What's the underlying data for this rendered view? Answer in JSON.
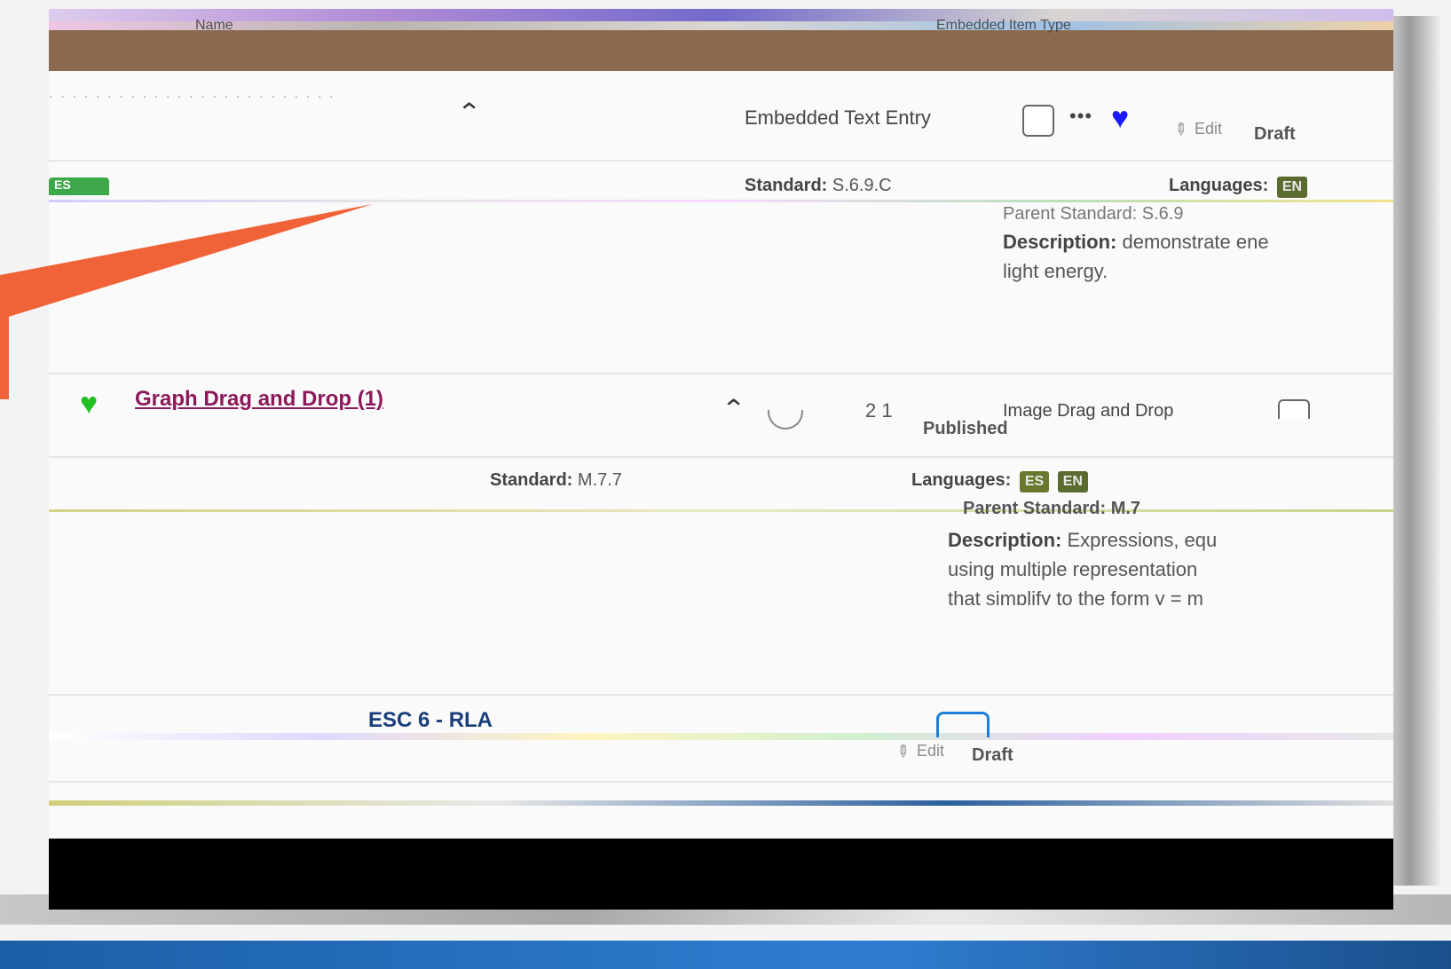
{
  "header": {
    "name_col": "Name",
    "type_col": "Embedded Item Type"
  },
  "rows": [
    {
      "type": "Embedded Text Entry",
      "status": "Draft",
      "edit_label": "Edit",
      "standard_label": "Standard:",
      "standard_value": "S.6.9.C",
      "languages_label": "Languages:",
      "languages": [
        "EN"
      ],
      "parent_standard_label": "Parent Standard:",
      "parent_standard_value": "S.6.9",
      "description_label": "Description:",
      "description_value": "demonstrate ene light energy.",
      "tag": "ES"
    },
    {
      "title": "Graph Drag and Drop (1)",
      "type": "Image Drag and Drop",
      "status": "Published",
      "counts": "2 1",
      "standard_label": "Standard:",
      "standard_value": "M.7.7",
      "languages_label": "Languages:",
      "languages": [
        "ES",
        "EN"
      ],
      "parent_standard_label": "Parent Standard:",
      "parent_standard_value": "M.7",
      "description_label": "Description:",
      "description_value": "Expressions, equ using multiple representation that simplify to the form y = m"
    },
    {
      "title": "ESC 6 - RLA",
      "status": "Draft",
      "edit_label": "Edit"
    }
  ],
  "colors": {
    "accent_arrow": "#f06237",
    "heart_blue": "#1a1aff",
    "heart_green": "#20c020",
    "link_purple": "#8a1a5a",
    "link_blue": "#1a3e7a"
  },
  "icons": {
    "chevron": "chevron-up-icon",
    "more": "more-icon",
    "heart": "heart-icon",
    "edit": "pencil-icon"
  }
}
